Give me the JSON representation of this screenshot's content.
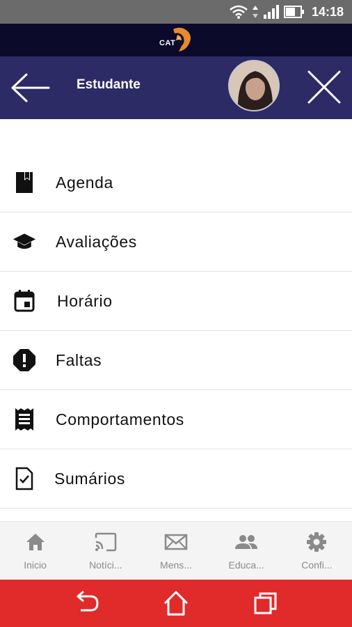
{
  "status_bar": {
    "time": "14:18"
  },
  "brand": {
    "logo_text": "CAT"
  },
  "header": {
    "title": "Estudante"
  },
  "menu": {
    "items": [
      {
        "label": "Agenda",
        "icon": "bookmark-book-icon"
      },
      {
        "label": "Avaliações",
        "icon": "graduation-cap-icon"
      },
      {
        "label": "Horário",
        "icon": "calendar-icon"
      },
      {
        "label": "Faltas",
        "icon": "alert-octagon-icon"
      },
      {
        "label": "Comportamentos",
        "icon": "receipt-icon"
      },
      {
        "label": "Sumários",
        "icon": "checked-document-icon"
      }
    ]
  },
  "tabs": [
    {
      "label": "Inicio",
      "icon": "home-icon"
    },
    {
      "label": "Notíci...",
      "icon": "cast-icon"
    },
    {
      "label": "Mens...",
      "icon": "mail-icon"
    },
    {
      "label": "Educa...",
      "icon": "people-icon"
    },
    {
      "label": "Confi...",
      "icon": "gear-icon"
    }
  ],
  "colors": {
    "header_bg": "#2d2b66",
    "brand_bg": "#0b0a2a",
    "navbar_bg": "#e12a2a",
    "tab_icon": "#8a8a8a"
  }
}
